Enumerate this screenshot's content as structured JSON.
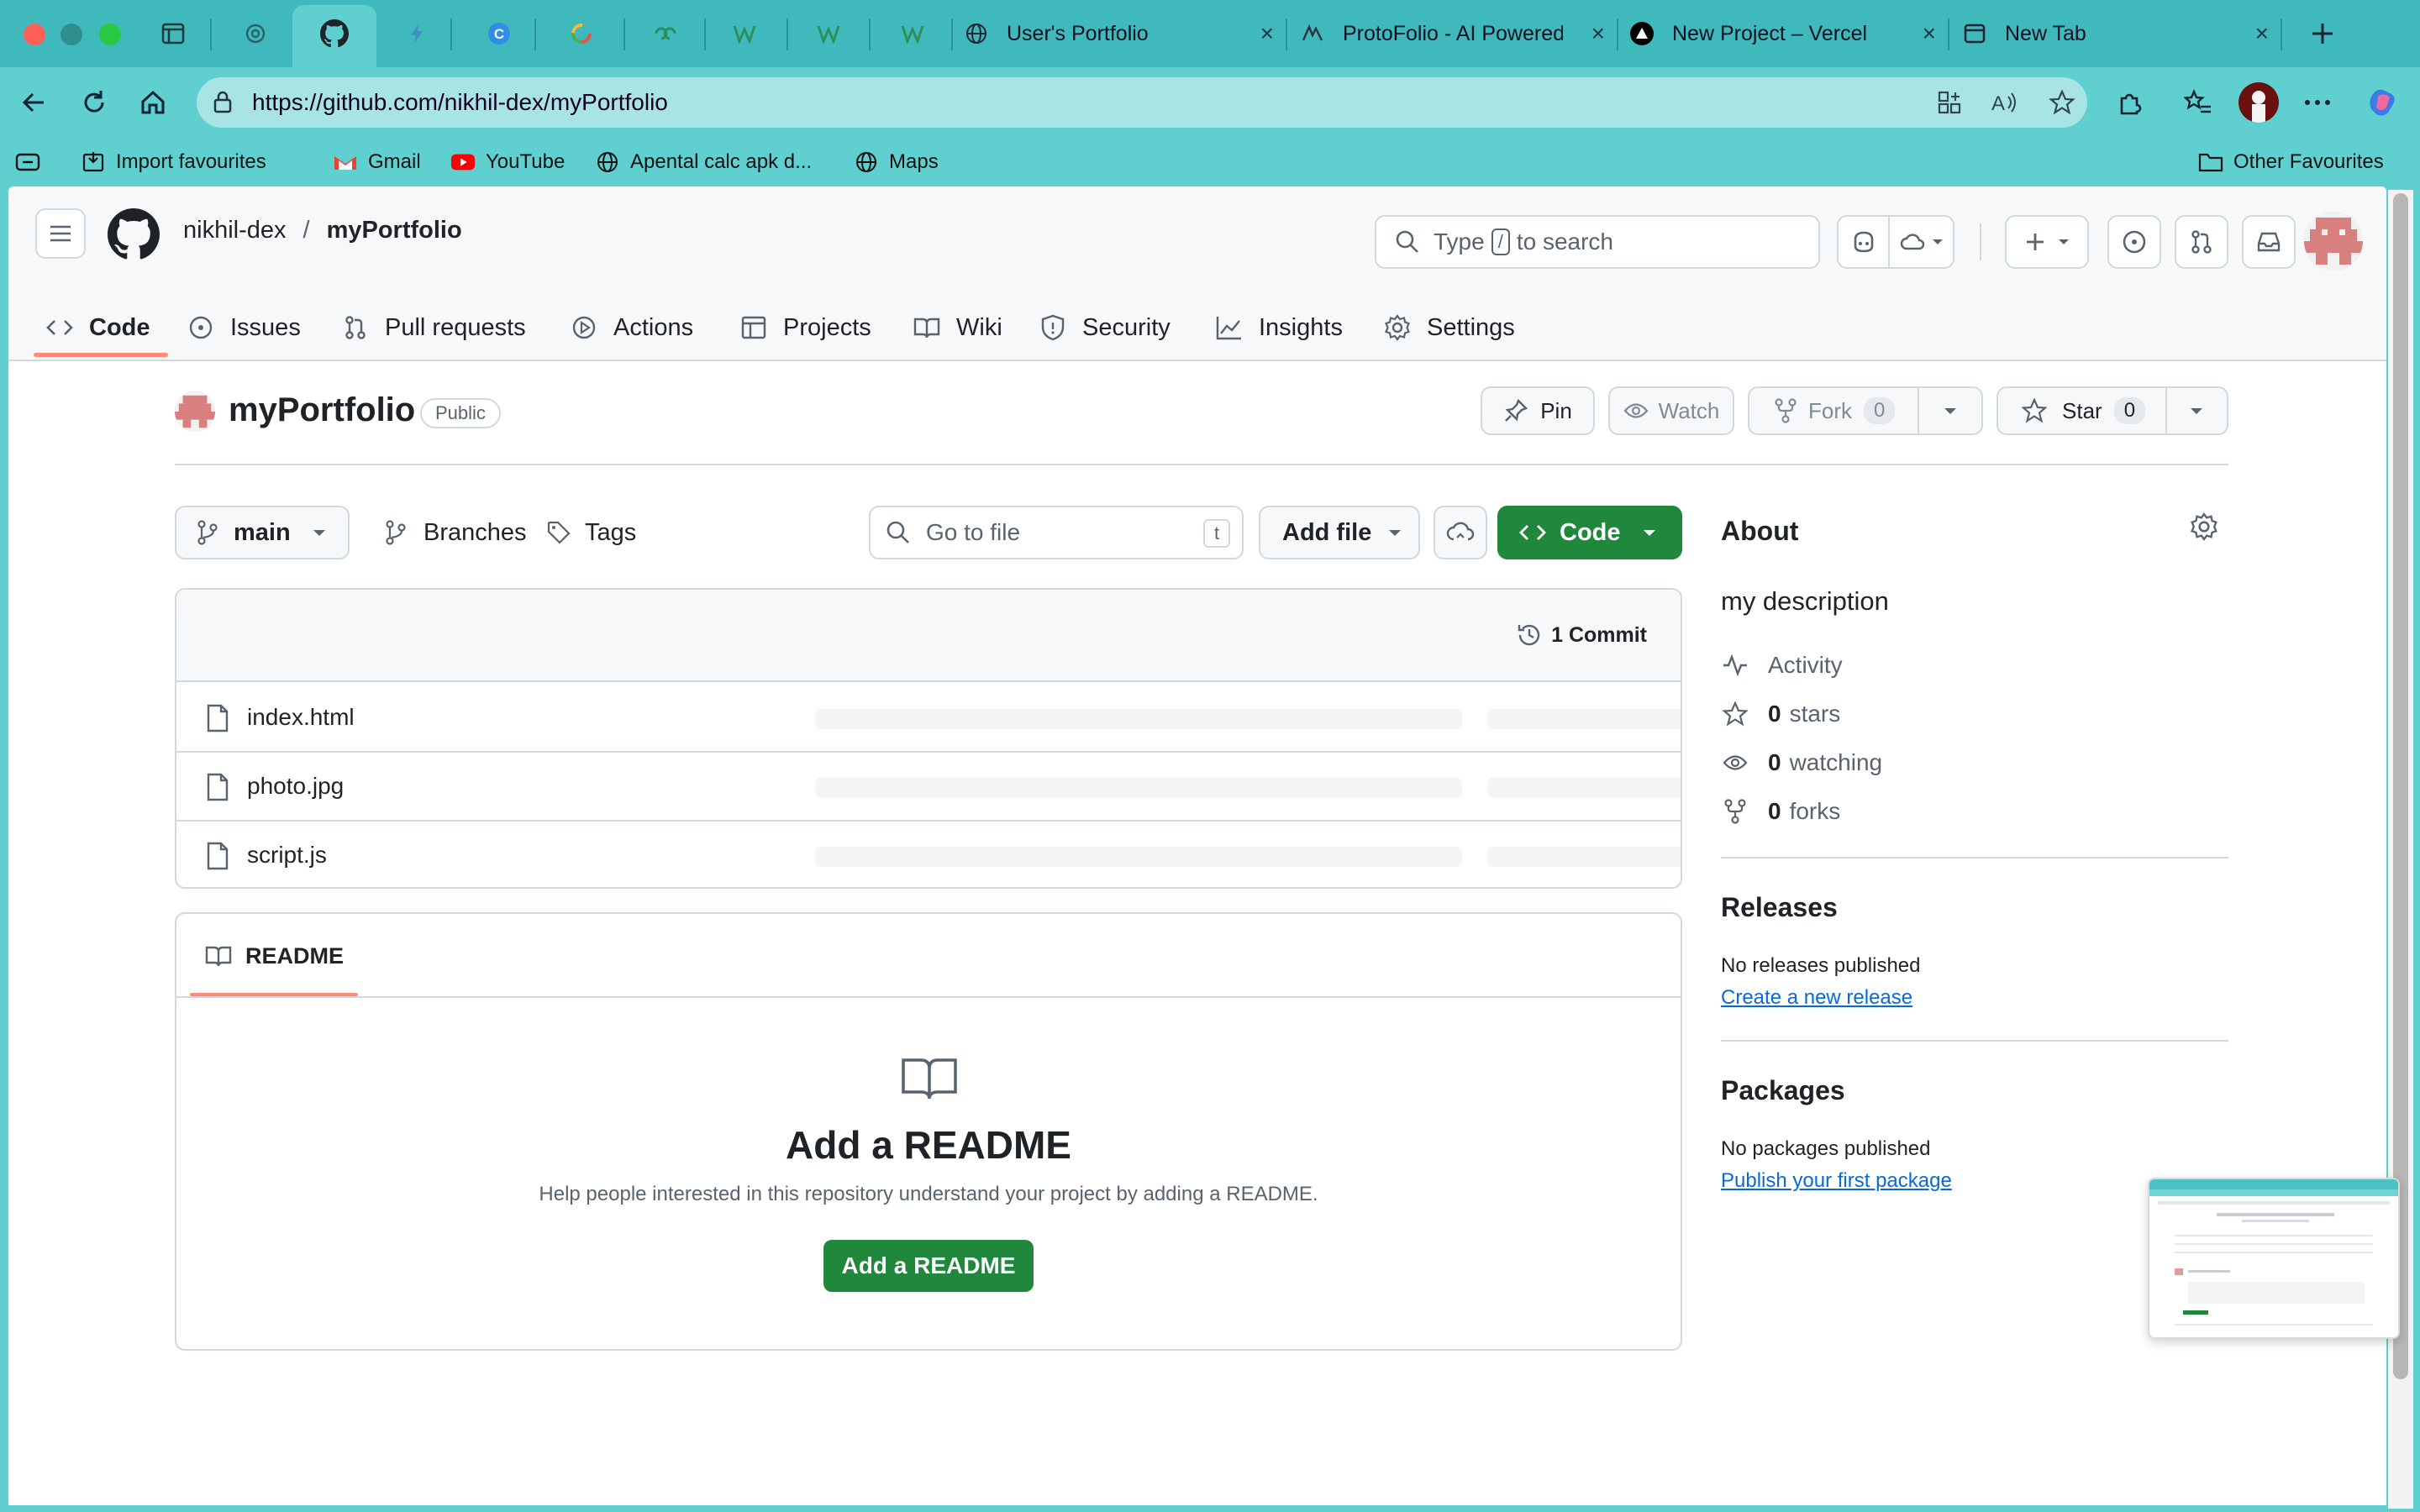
{
  "browser": {
    "tabs": [
      {
        "label": "User's Portfolio"
      },
      {
        "label": "ProtoFolio - AI Powered"
      },
      {
        "label": "New Project – Vercel"
      },
      {
        "label": "New Tab"
      }
    ],
    "close_glyph": "×",
    "url": "https://github.com/nikhil-dex/myPortfolio",
    "bookmarks": [
      {
        "label": "Import favourites"
      },
      {
        "label": "Gmail"
      },
      {
        "label": "YouTube"
      },
      {
        "label": "Apental calc apk d..."
      },
      {
        "label": "Maps"
      }
    ],
    "other_favourites": "Other Favourites"
  },
  "header": {
    "owner": "nikhil-dex",
    "separator": "/",
    "repo": "myPortfolio",
    "search_prefix": "Type",
    "search_key": "/",
    "search_suffix": "to search"
  },
  "repo_nav": [
    {
      "label": "Code",
      "icon": "code-icon"
    },
    {
      "label": "Issues",
      "icon": "issue-icon"
    },
    {
      "label": "Pull requests",
      "icon": "pull-request-icon"
    },
    {
      "label": "Actions",
      "icon": "play-icon"
    },
    {
      "label": "Projects",
      "icon": "table-icon"
    },
    {
      "label": "Wiki",
      "icon": "book-icon"
    },
    {
      "label": "Security",
      "icon": "shield-icon"
    },
    {
      "label": "Insights",
      "icon": "graph-icon"
    },
    {
      "label": "Settings",
      "icon": "gear-icon"
    }
  ],
  "repo": {
    "title": "myPortfolio",
    "visibility": "Public",
    "pin_label": "Pin",
    "watch_label": "Watch",
    "fork_label": "Fork",
    "fork_count": "0",
    "star_label": "Star",
    "star_count": "0"
  },
  "controls": {
    "branch": "main",
    "branches_label": "Branches",
    "tags_label": "Tags",
    "goto_placeholder": "Go to file",
    "goto_key": "t",
    "add_file_label": "Add file",
    "code_label": "Code"
  },
  "files": {
    "commit_count": "1 Commit",
    "items": [
      {
        "name": "index.html"
      },
      {
        "name": "photo.jpg"
      },
      {
        "name": "script.js"
      }
    ]
  },
  "readme": {
    "tab_label": "README",
    "title": "Add a README",
    "description": "Help people interested in this repository understand your project by adding a README.",
    "button_label": "Add a README"
  },
  "sidebar": {
    "about_title": "About",
    "description": "my description",
    "activity_label": "Activity",
    "stars": {
      "count": "0",
      "label": "stars"
    },
    "watching": {
      "count": "0",
      "label": "watching"
    },
    "forks": {
      "count": "0",
      "label": "forks"
    },
    "releases_title": "Releases",
    "releases_empty": "No releases published",
    "releases_link": "Create a new release",
    "packages_title": "Packages",
    "packages_empty": "No packages published",
    "packages_link": "Publish your first package"
  },
  "colors": {
    "chrome": "#5fcfcf",
    "primary_green": "#1f883d",
    "accent_underline": "#fd8c73",
    "link": "#0969da"
  }
}
